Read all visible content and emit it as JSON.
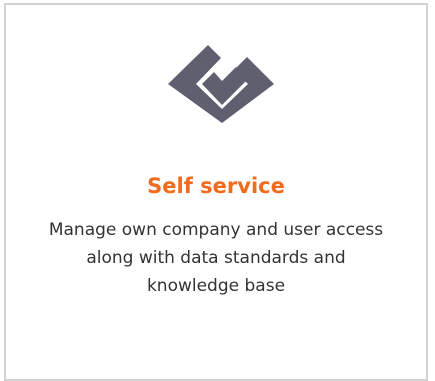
{
  "card": {
    "icon": "check-diamond-icon",
    "title": "Self service",
    "description": "Manage own company and user access along with data standards and knowledge base"
  },
  "colors": {
    "title": "#f26a1b",
    "icon": "#5e5f6f",
    "border": "#d3d3d3",
    "text": "#333333"
  }
}
